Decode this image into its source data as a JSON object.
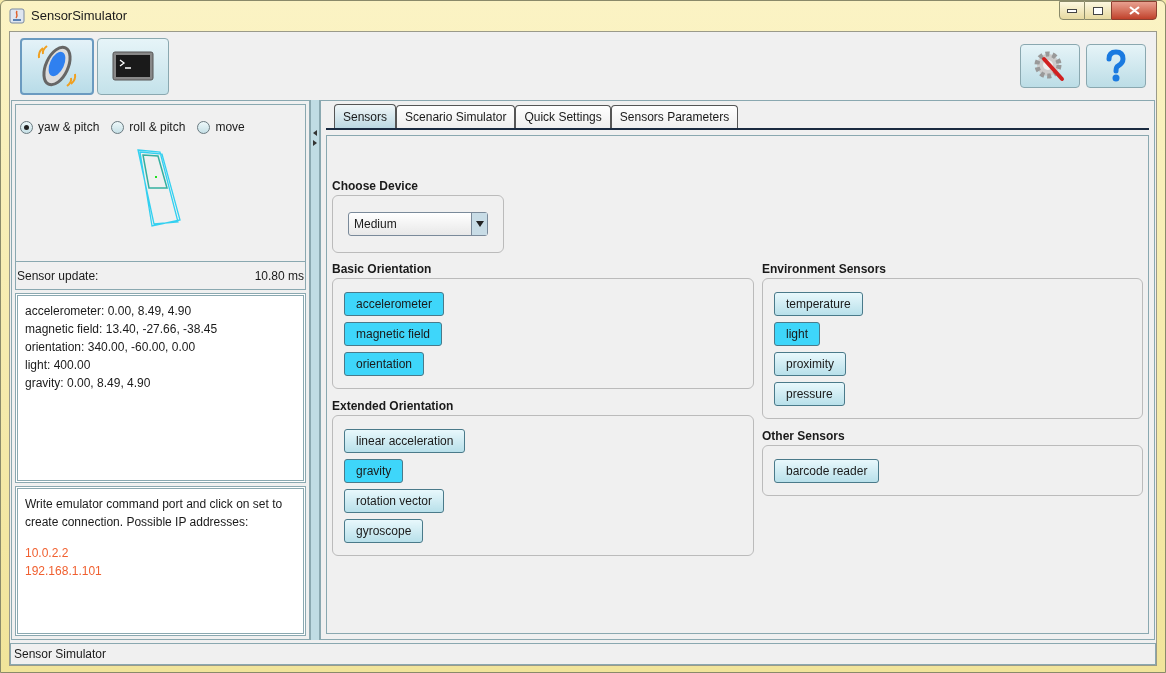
{
  "window": {
    "title": "SensorSimulator"
  },
  "toolbar": [
    {
      "kind": "motion",
      "selected": true
    },
    {
      "kind": "terminal",
      "selected": false
    }
  ],
  "toolbar_right": [
    {
      "kind": "settings"
    },
    {
      "kind": "help"
    }
  ],
  "view_modes": [
    {
      "label": "yaw & pitch",
      "selected": true
    },
    {
      "label": "roll & pitch",
      "selected": false
    },
    {
      "label": "move",
      "selected": false
    }
  ],
  "sensor_update": {
    "label": "Sensor update:",
    "value": "10.80 ms"
  },
  "readings": [
    "accelerometer: 0.00, 8.49, 4.90",
    "magnetic field: 13.40, -27.66, -38.45",
    "orientation: 340.00, -60.00, 0.00",
    "light: 400.00",
    "gravity: 0.00, 8.49, 4.90"
  ],
  "info": {
    "text": "Write emulator command port and click on set to create connection. Possible IP addresses:",
    "addresses": [
      "10.0.2.2",
      "192.168.1.101"
    ]
  },
  "tabs": [
    {
      "label": "Sensors",
      "selected": true
    },
    {
      "label": "Scenario Simulator",
      "selected": false
    },
    {
      "label": "Quick Settings",
      "selected": false
    },
    {
      "label": "Sensors Parameters",
      "selected": false
    }
  ],
  "choose_device": {
    "title": "Choose Device",
    "value": "Medium"
  },
  "groups_left": [
    {
      "title": "Basic Orientation",
      "sensors": [
        {
          "label": "accelerometer",
          "enabled": true
        },
        {
          "label": "magnetic field",
          "enabled": true
        },
        {
          "label": "orientation",
          "enabled": true
        }
      ]
    },
    {
      "title": "Extended Orientation",
      "sensors": [
        {
          "label": "linear acceleration",
          "enabled": false
        },
        {
          "label": "gravity",
          "enabled": true
        },
        {
          "label": "rotation vector",
          "enabled": false
        },
        {
          "label": "gyroscope",
          "enabled": false
        }
      ]
    }
  ],
  "groups_right": [
    {
      "title": "Environment Sensors",
      "sensors": [
        {
          "label": "temperature",
          "enabled": false
        },
        {
          "label": "light",
          "enabled": true
        },
        {
          "label": "proximity",
          "enabled": false
        },
        {
          "label": "pressure",
          "enabled": false
        }
      ]
    },
    {
      "title": "Other Sensors",
      "sensors": [
        {
          "label": "barcode reader",
          "enabled": false
        }
      ]
    }
  ],
  "status_bar": "Sensor Simulator"
}
